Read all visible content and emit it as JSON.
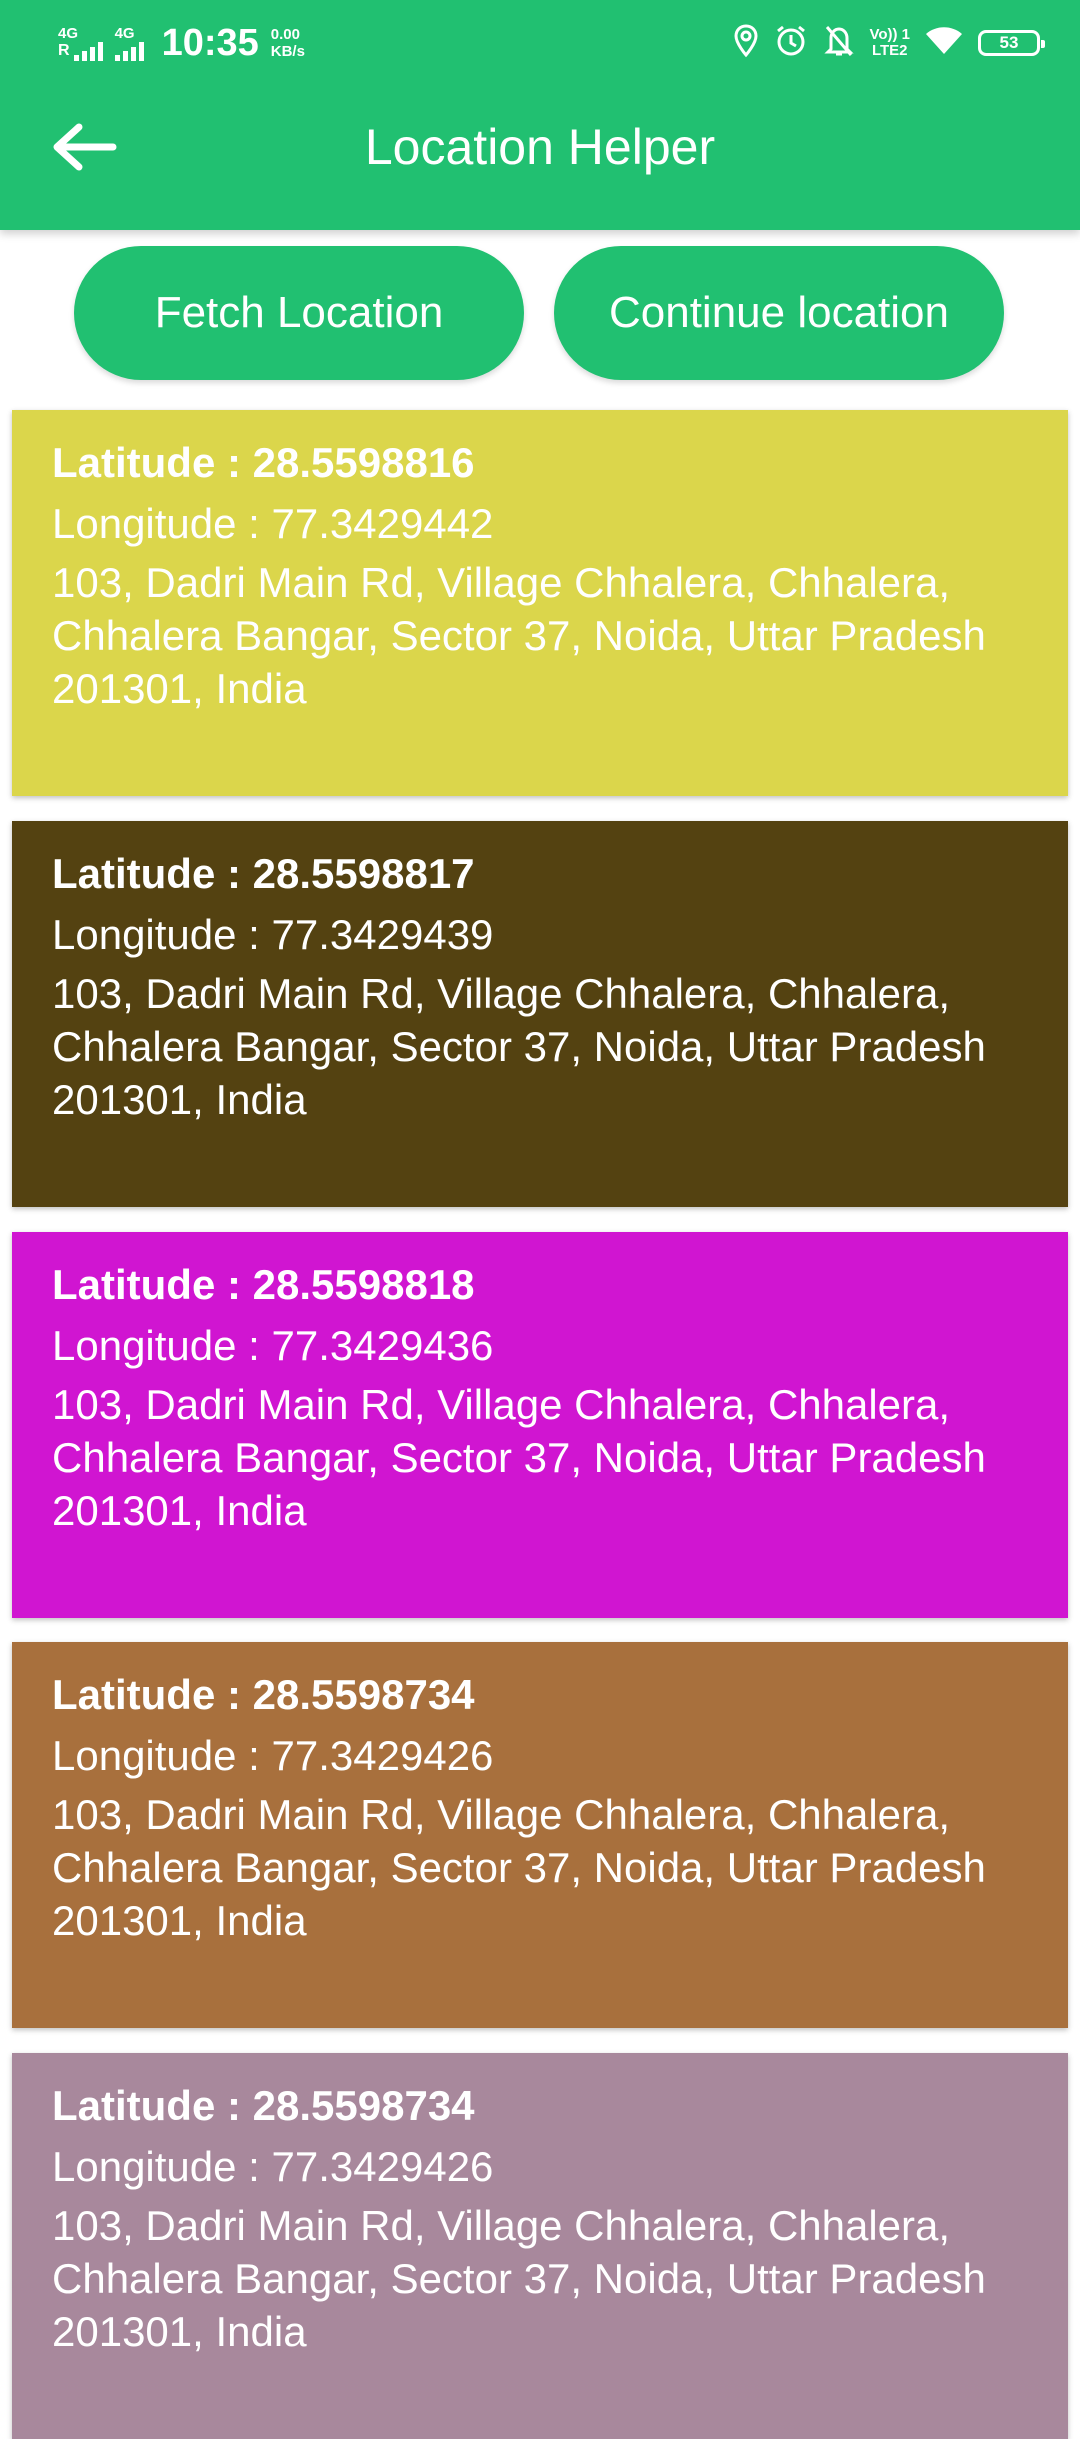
{
  "status_bar": {
    "net1": "4G",
    "net1_roaming": "R",
    "net2": "4G",
    "time": "10:35",
    "speed_value": "0.00",
    "speed_unit": "KB/s",
    "volte_top": "Vo)) 1",
    "volte_bottom": "LTE2",
    "battery": "53",
    "icons": [
      "location-icon",
      "alarm-icon",
      "mute-bell-icon",
      "wifi-icon",
      "battery-icon"
    ]
  },
  "toolbar": {
    "title": "Location Helper",
    "back_icon": "back-arrow-icon"
  },
  "actions": {
    "fetch_label": "Fetch Location",
    "continue_label": "Continue location"
  },
  "locations": [
    {
      "latitude": "Latitude : 28.5598816",
      "longitude": "Longitude : 77.3429442",
      "address": "103, Dadri Main Rd, Village Chhalera, Chhalera, Chhalera Bangar, Sector 37, Noida, Uttar Pradesh 201301, India",
      "color": "#dbd64b"
    },
    {
      "latitude": "Latitude : 28.5598817",
      "longitude": "Longitude : 77.3429439",
      "address": "103, Dadri Main Rd, Village Chhalera, Chhalera, Chhalera Bangar, Sector 37, Noida, Uttar Pradesh 201301, India",
      "color": "#544211"
    },
    {
      "latitude": "Latitude : 28.5598818",
      "longitude": "Longitude : 77.3429436",
      "address": "103, Dadri Main Rd, Village Chhalera, Chhalera, Chhalera Bangar, Sector 37, Noida, Uttar Pradesh 201301, India",
      "color": "#d015d1"
    },
    {
      "latitude": "Latitude : 28.5598734",
      "longitude": "Longitude : 77.3429426",
      "address": "103, Dadri Main Rd, Village Chhalera, Chhalera, Chhalera Bangar, Sector 37, Noida, Uttar Pradesh 201301, India",
      "color": "#a8703d"
    },
    {
      "latitude": "Latitude : 28.5598734",
      "longitude": "Longitude : 77.3429426",
      "address": "103, Dadri Main Rd, Village Chhalera, Chhalera, Chhalera Bangar, Sector 37, Noida, Uttar Pradesh 201301, India",
      "color": "#a8889c"
    }
  ],
  "colors": {
    "primary": "#21c071",
    "text_on_primary": "#ffffff"
  }
}
